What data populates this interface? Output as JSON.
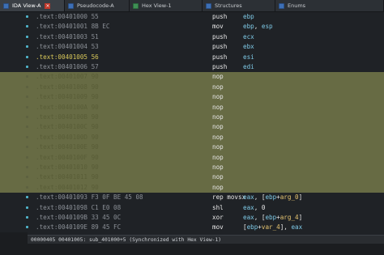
{
  "tabs": [
    {
      "label": "IDA View-A",
      "active": true,
      "closable": true,
      "icon": "listing-icon"
    },
    {
      "label": "Pseudocode-A",
      "active": false,
      "closable": false,
      "icon": "pseudocode-icon"
    },
    {
      "label": "Hex View-1",
      "active": false,
      "closable": false,
      "icon": "hex-icon"
    },
    {
      "label": "Structures",
      "active": false,
      "closable": false,
      "icon": "structures-icon"
    },
    {
      "label": "Enums",
      "active": false,
      "closable": false,
      "icon": "enums-icon"
    }
  ],
  "rows": [
    {
      "addr": ".text:00401000 55",
      "mnem": "push",
      "ops": [
        {
          "t": "ebp",
          "c": "reg"
        }
      ],
      "style": "normal"
    },
    {
      "addr": ".text:00401001 8B EC",
      "mnem": "mov",
      "ops": [
        {
          "t": "ebp",
          "c": "reg"
        },
        {
          "t": ", ",
          "c": ""
        },
        {
          "t": "esp",
          "c": "reg"
        }
      ],
      "style": "normal"
    },
    {
      "addr": ".text:00401003 51",
      "mnem": "push",
      "ops": [
        {
          "t": "ecx",
          "c": "reg"
        }
      ],
      "style": "normal"
    },
    {
      "addr": ".text:00401004 53",
      "mnem": "push",
      "ops": [
        {
          "t": "ebx",
          "c": "reg"
        }
      ],
      "style": "normal"
    },
    {
      "addr": ".text:00401005 56",
      "mnem": "push",
      "ops": [
        {
          "t": "esi",
          "c": "reg"
        }
      ],
      "style": "highlight"
    },
    {
      "addr": ".text:00401006 57",
      "mnem": "push",
      "ops": [
        {
          "t": "edi",
          "c": "reg"
        }
      ],
      "style": "normal"
    },
    {
      "addr": ".text:00401007 90",
      "mnem": "nop",
      "ops": [],
      "style": "selected"
    },
    {
      "addr": ".text:00401008 90",
      "mnem": "nop",
      "ops": [],
      "style": "selected"
    },
    {
      "addr": ".text:00401009 90",
      "mnem": "nop",
      "ops": [],
      "style": "selected"
    },
    {
      "addr": ".text:0040100A 90",
      "mnem": "nop",
      "ops": [],
      "style": "selected"
    },
    {
      "addr": ".text:0040100B 90",
      "mnem": "nop",
      "ops": [],
      "style": "selected"
    },
    {
      "addr": ".text:0040100C 90",
      "mnem": "nop",
      "ops": [],
      "style": "selected"
    },
    {
      "addr": ".text:0040100D 90",
      "mnem": "nop",
      "ops": [],
      "style": "selected"
    },
    {
      "addr": ".text:0040100E 90",
      "mnem": "nop",
      "ops": [],
      "style": "selected"
    },
    {
      "addr": ".text:0040100F 90",
      "mnem": "nop",
      "ops": [],
      "style": "selected"
    },
    {
      "addr": ".text:00401010 90",
      "mnem": "nop",
      "ops": [],
      "style": "selected"
    },
    {
      "addr": ".text:00401011 90",
      "mnem": "nop",
      "ops": [],
      "style": "selected"
    },
    {
      "addr": ".text:00401012 90",
      "mnem": "nop",
      "ops": [],
      "style": "selected"
    },
    {
      "addr": ".text:00401093 F3 0F BE 45 08",
      "mnem": "rep movsx",
      "ops": [
        {
          "t": "eax",
          "c": "reg"
        },
        {
          "t": ", [",
          "c": ""
        },
        {
          "t": "ebp",
          "c": "reg"
        },
        {
          "t": "+",
          "c": ""
        },
        {
          "t": "arg_0",
          "c": "var"
        },
        {
          "t": "]",
          "c": ""
        }
      ],
      "style": "normal"
    },
    {
      "addr": ".text:00401098 C1 E0 08",
      "mnem": "shl",
      "ops": [
        {
          "t": "eax",
          "c": "reg"
        },
        {
          "t": ", 0",
          "c": ""
        }
      ],
      "style": "normal"
    },
    {
      "addr": ".text:0040109B 33 45 0C",
      "mnem": "xor",
      "ops": [
        {
          "t": "eax",
          "c": "reg"
        },
        {
          "t": ", [",
          "c": ""
        },
        {
          "t": "ebp",
          "c": "reg"
        },
        {
          "t": "+",
          "c": ""
        },
        {
          "t": "arg_4",
          "c": "var"
        },
        {
          "t": "]",
          "c": ""
        }
      ],
      "style": "normal"
    },
    {
      "addr": ".text:0040109E 89 45 FC",
      "mnem": "mov",
      "ops": [
        {
          "t": "[",
          "c": ""
        },
        {
          "t": "ebp",
          "c": "reg"
        },
        {
          "t": "+",
          "c": ""
        },
        {
          "t": "var_4",
          "c": "var"
        },
        {
          "t": "], ",
          "c": ""
        },
        {
          "t": "eax",
          "c": "reg"
        }
      ],
      "style": "normal"
    },
    {
      "addr": ".text:004010A1 8B 45 FC",
      "mnem": "mov",
      "ops": [
        {
          "t": "eax",
          "c": "reg"
        },
        {
          "t": ", [",
          "c": ""
        },
        {
          "t": "ebp",
          "c": "reg"
        },
        {
          "t": "+",
          "c": ""
        },
        {
          "t": "var_4",
          "c": "var"
        },
        {
          "t": "]",
          "c": ""
        }
      ],
      "style": "normal"
    }
  ],
  "status": "00000405 00401005: sub_401000+5 (Synchronized with Hex View-1)",
  "colors": {
    "selection": "#676b44",
    "register": "#7ec9e6",
    "variable": "#e6c470",
    "highlight_address": "#d8c85a",
    "bullet": "#4fb3c9"
  }
}
